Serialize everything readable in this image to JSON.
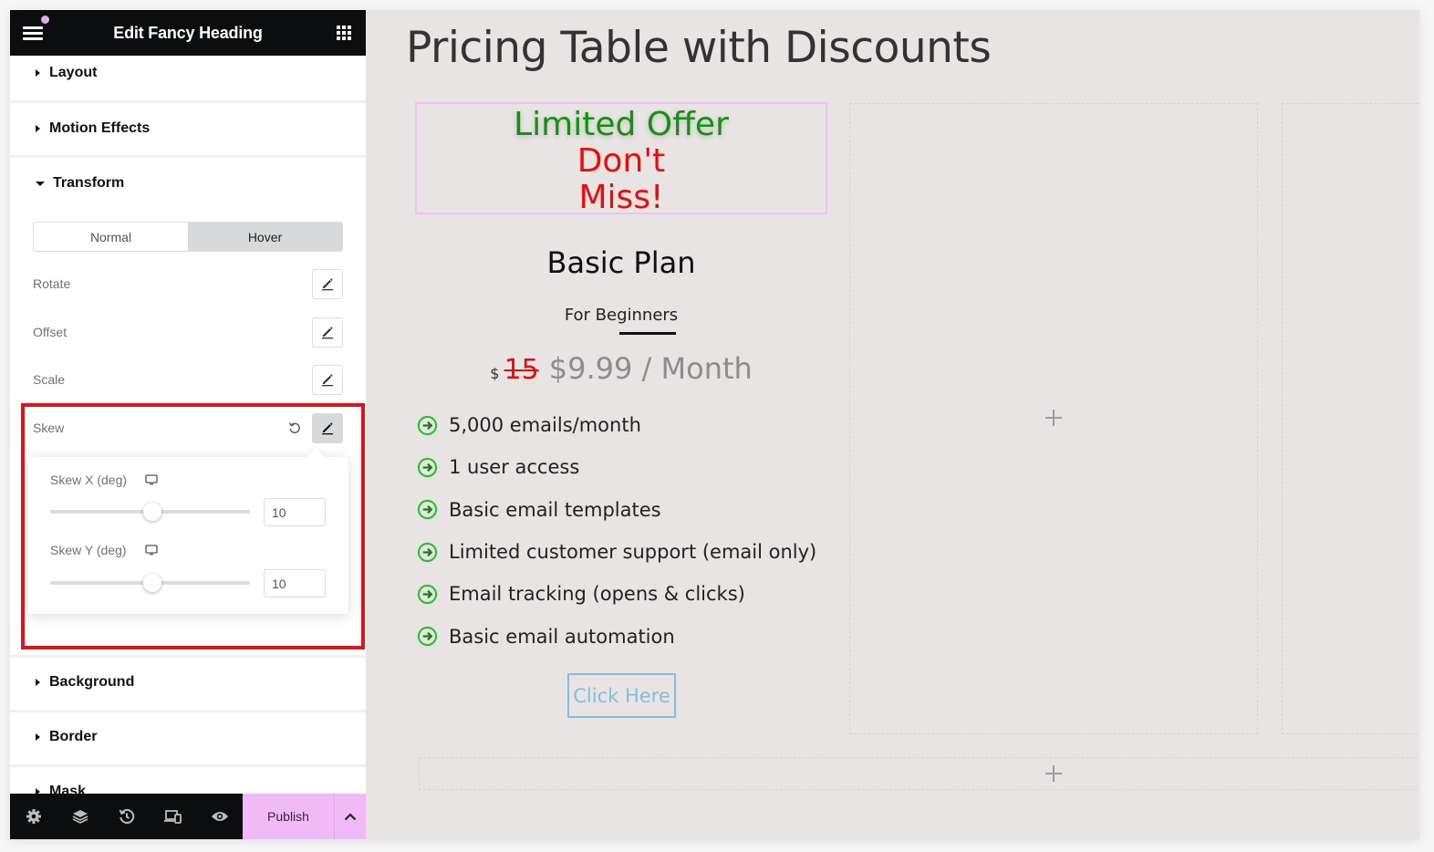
{
  "sidebar": {
    "header": {
      "title": "Edit Fancy Heading",
      "notification_dot_color": "#e9a6f2"
    },
    "sections": {
      "layout": "Layout",
      "motion_effects": "Motion Effects",
      "transform": "Transform",
      "background": "Background",
      "border": "Border",
      "mask": "Mask"
    },
    "transform": {
      "tabs": [
        {
          "label": "Normal",
          "active": false
        },
        {
          "label": "Hover",
          "active": true
        }
      ],
      "controls": {
        "rotate": "Rotate",
        "offset": "Offset",
        "scale": "Scale",
        "skew": "Skew"
      },
      "skew_popover": {
        "skew_x": {
          "label": "Skew X (deg)",
          "value": "10",
          "slider_fraction": 0.51
        },
        "skew_y": {
          "label": "Skew Y (deg)",
          "value": "10",
          "slider_fraction": 0.51
        }
      }
    },
    "footer": {
      "icons": [
        "settings-icon",
        "layers-icon",
        "history-icon",
        "responsive-icon",
        "preview-icon"
      ],
      "publish_label": "Publish"
    },
    "highlight_color": "#e0121a"
  },
  "canvas": {
    "page_title": "Pricing Table with Discounts",
    "offer": {
      "line1": "Limited Offer",
      "line2": "Don't",
      "line3": "Miss!",
      "line1_color": "#13920f",
      "line2_color": "#ef0a0a"
    },
    "plan": {
      "name": "Basic Plan",
      "subtitle": "For Beginners",
      "currency": "$",
      "original_price": "15",
      "price": "$9.99 / Month",
      "features": [
        "5,000 emails/month",
        "1 user access",
        "Basic email templates",
        "Limited customer support (email only)",
        "Email tracking (opens & clicks)",
        "Basic email automation"
      ],
      "button_label": "Click Here",
      "accent_color": "#7ec1dc",
      "check_color": "#22c521"
    }
  }
}
